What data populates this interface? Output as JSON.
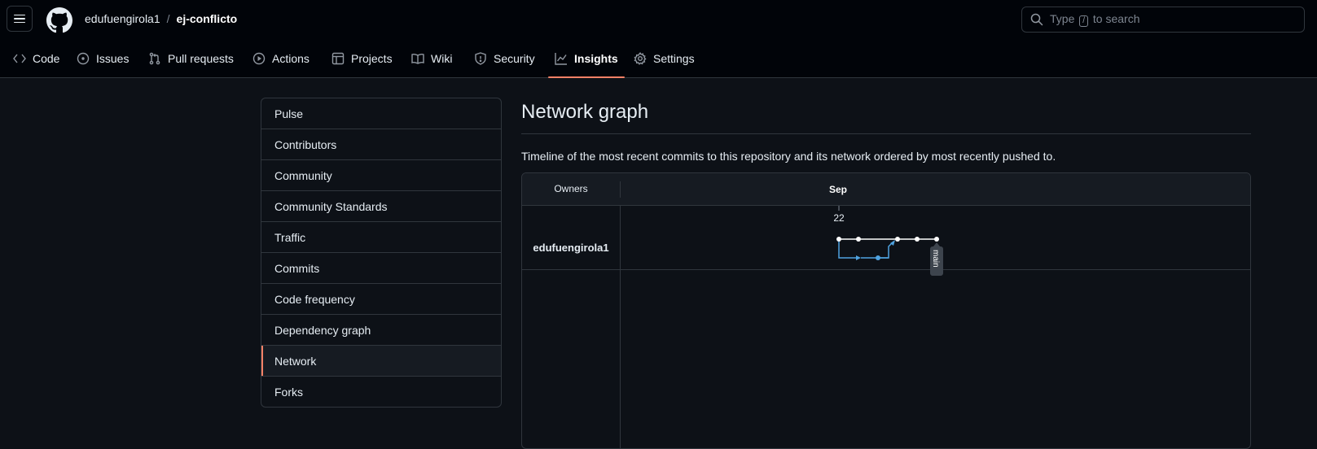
{
  "header": {
    "owner": "edufuengirola1",
    "separator": "/",
    "repo": "ej-conflicto",
    "search_placeholder_pre": "Type",
    "search_key": "/",
    "search_placeholder_post": "to search"
  },
  "repo_nav": [
    {
      "label": "Code",
      "icon": "code-icon"
    },
    {
      "label": "Issues",
      "icon": "issue-icon"
    },
    {
      "label": "Pull requests",
      "icon": "pull-request-icon"
    },
    {
      "label": "Actions",
      "icon": "play-icon"
    },
    {
      "label": "Projects",
      "icon": "table-icon"
    },
    {
      "label": "Wiki",
      "icon": "book-icon"
    },
    {
      "label": "Security",
      "icon": "shield-icon"
    },
    {
      "label": "Insights",
      "icon": "graph-icon",
      "active": true
    },
    {
      "label": "Settings",
      "icon": "gear-icon"
    }
  ],
  "sidebar": {
    "items": [
      {
        "label": "Pulse"
      },
      {
        "label": "Contributors"
      },
      {
        "label": "Community"
      },
      {
        "label": "Community Standards"
      },
      {
        "label": "Traffic"
      },
      {
        "label": "Commits"
      },
      {
        "label": "Code frequency"
      },
      {
        "label": "Dependency graph"
      },
      {
        "label": "Network",
        "selected": true
      },
      {
        "label": "Forks"
      }
    ]
  },
  "main": {
    "title": "Network graph",
    "description": "Timeline of the most recent commits to this repository and its network ordered by most recently pushed to."
  },
  "network": {
    "owners_header": "Owners",
    "month": "Sep",
    "day": "22",
    "owner": "edufuengirola1",
    "branch_label": "main",
    "colors": {
      "main": "#ffffff",
      "branch": "#4fa3e0",
      "accent": "#f78166"
    }
  }
}
